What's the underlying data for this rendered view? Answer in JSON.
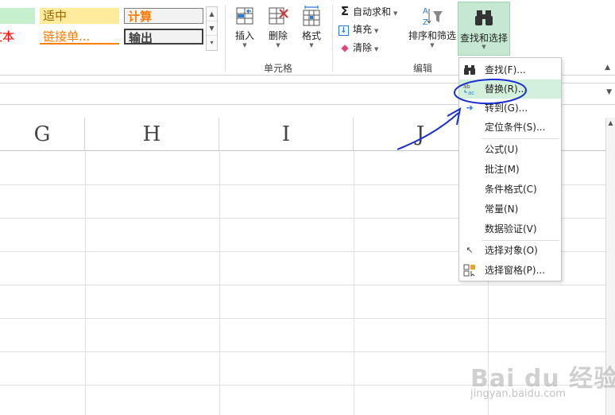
{
  "ribbon": {
    "styles": [
      {
        "label": "适中",
        "color": "#9c6500",
        "bg": "#ffeb9c"
      },
      {
        "label": "计算",
        "color": "#fa7d00",
        "bg": "#f2f2f2"
      },
      {
        "label": "文本",
        "color": "#ff0000",
        "bg": "#ffffff"
      },
      {
        "label": "链接单...",
        "color": "#fa7d00",
        "bg": "#ffffff"
      },
      {
        "label": "输出",
        "color": "#3f3f3f",
        "bg": "#f2f2f2"
      }
    ],
    "cells_group": {
      "label": "单元格",
      "insert": "插入",
      "delete": "删除",
      "format": "格式"
    },
    "edit_group": {
      "label": "编辑",
      "autosum": "自动求和",
      "fill": "填充",
      "clear": "清除",
      "sort_filter": "排序和筛选",
      "find_select": "查找和选择"
    }
  },
  "columns": [
    "G",
    "H",
    "I",
    "J"
  ],
  "find_menu": {
    "items": [
      {
        "label": "查找(F)...",
        "icon": "binoculars-icon",
        "glyph": "🔭"
      },
      {
        "label": "替换(R)...",
        "icon": "replace-icon",
        "glyph": "ab",
        "highlighted": true
      },
      {
        "label": "转到(G)...",
        "icon": "goto-arrow-icon",
        "glyph": "➜"
      },
      {
        "label": "定位条件(S)...",
        "icon": "",
        "glyph": ""
      },
      {
        "label": "公式(U)",
        "icon": "",
        "glyph": ""
      },
      {
        "label": "批注(M)",
        "icon": "",
        "glyph": ""
      },
      {
        "label": "条件格式(C)",
        "icon": "",
        "glyph": ""
      },
      {
        "label": "常量(N)",
        "icon": "",
        "glyph": ""
      },
      {
        "label": "数据验证(V)",
        "icon": "",
        "glyph": ""
      },
      {
        "label": "选择对象(O)",
        "icon": "cursor-arrow-icon",
        "glyph": "↖"
      },
      {
        "label": "选择窗格(P)...",
        "icon": "selection-pane-icon",
        "glyph": "▣"
      }
    ]
  },
  "watermark": {
    "logo": "Bai du 经验",
    "url": "jingyan.baidu.com"
  },
  "colors": {
    "accent_green": "#217346",
    "highlight": "#d3f0dd",
    "annotation_blue": "#1a2fd0"
  }
}
